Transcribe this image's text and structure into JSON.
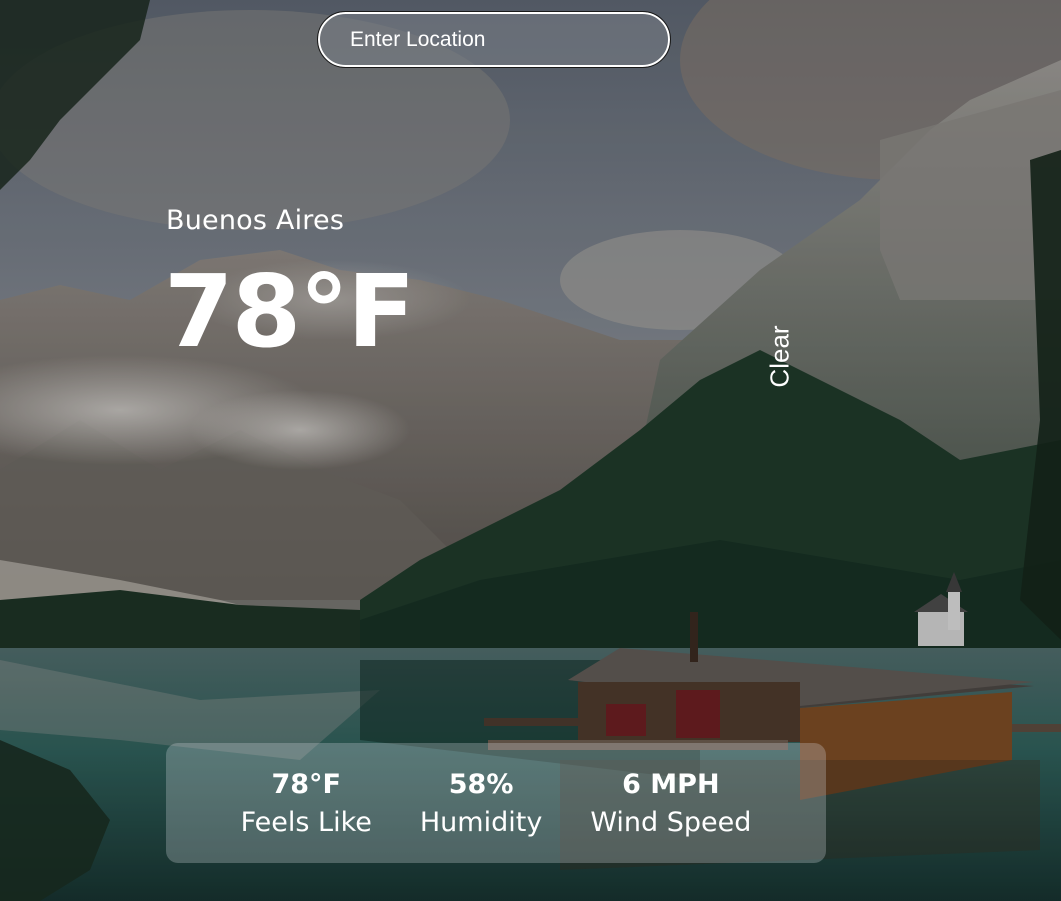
{
  "search": {
    "placeholder": "Enter Location",
    "value": ""
  },
  "location": {
    "city": "Buenos Aires"
  },
  "current": {
    "temperature": "78°F",
    "condition": "Clear"
  },
  "details": [
    {
      "value": "78°F",
      "label": "Feels Like"
    },
    {
      "value": "58%",
      "label": "Humidity"
    },
    {
      "value": "6 MPH",
      "label": "Wind Speed"
    }
  ],
  "background": {
    "image": "mountain-lake-boathouse-photo",
    "colors": {
      "sky": "#6b7178",
      "forest": "#1f3a2a",
      "water": "#2c5a55",
      "cabin": "#6a4328"
    }
  }
}
